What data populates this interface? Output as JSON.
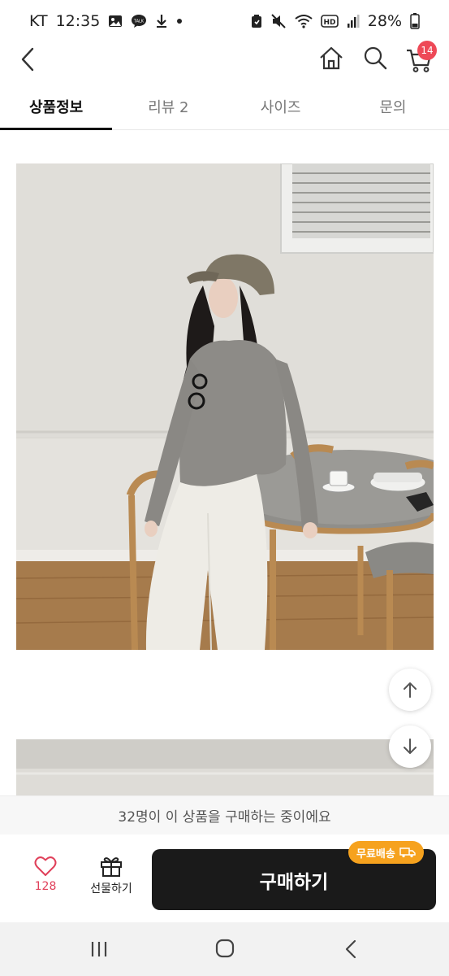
{
  "status_bar": {
    "carrier": "KT",
    "time": "12:35",
    "battery": "28%",
    "talk_badge": "TALK",
    "hd_badge": "HD"
  },
  "nav": {
    "cart_count": "14"
  },
  "tabs": [
    {
      "label": "상품정보",
      "active": true
    },
    {
      "label": "리뷰 2",
      "active": false
    },
    {
      "label": "사이즈",
      "active": false
    },
    {
      "label": "문의",
      "active": false
    }
  ],
  "notice": "32명이 이 상품을 구매하는 중이에요",
  "action_bar": {
    "like_count": "128",
    "gift_label": "선물하기",
    "buy_label": "구매하기",
    "free_shipping_badge": "무료배송"
  },
  "colors": {
    "accent_red": "#ee4957",
    "buy_button": "#1a1a1a",
    "shipping_badge": "#f6a21e"
  },
  "icons": [
    "back-icon",
    "home-icon",
    "search-icon",
    "cart-icon",
    "heart-icon",
    "gift-icon",
    "truck-icon",
    "arrow-up-icon",
    "arrow-down-icon"
  ]
}
